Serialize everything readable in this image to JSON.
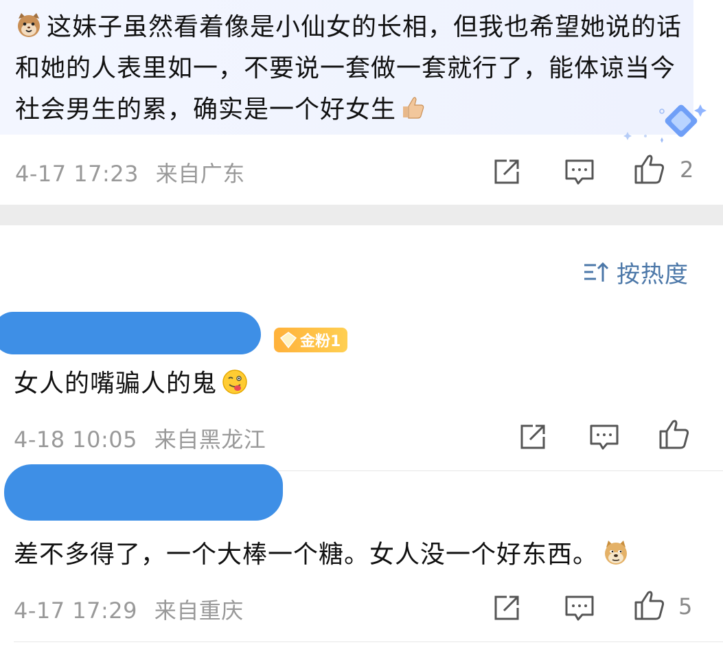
{
  "top_comment": {
    "text": "这妹子虽然看着像是小仙女的长相，但我也希望她说的话和她的人表里如一，不要说一套做一套就行了，能体谅当今社会男生的累，确实是一个好女生",
    "leading_emoji": "cat-face-emoji",
    "trailing_emoji": "thumbs-up-emoji",
    "timestamp": "4-17 17:23",
    "location": "来自广东",
    "like_count": "2"
  },
  "sort": {
    "label": "按热度",
    "icon": "sort-icon"
  },
  "comments": [
    {
      "badge": "金粉1",
      "text": "女人的嘴骗人的鬼",
      "emoji": "tongue-face-emoji",
      "timestamp": "4-18 10:05",
      "location": "来自黑龙江",
      "like_count": ""
    },
    {
      "text": "差不多得了，一个大棒一个糖。女人没一个好东西。",
      "emoji": "doge-emoji",
      "timestamp": "4-17 17:29",
      "location": "来自重庆",
      "like_count": "5"
    }
  ],
  "colors": {
    "accent": "#4b77a8",
    "meta_text": "#999999",
    "redaction": "#3e8fe6",
    "badge": "#ffb13a",
    "separator": "#ececec"
  }
}
